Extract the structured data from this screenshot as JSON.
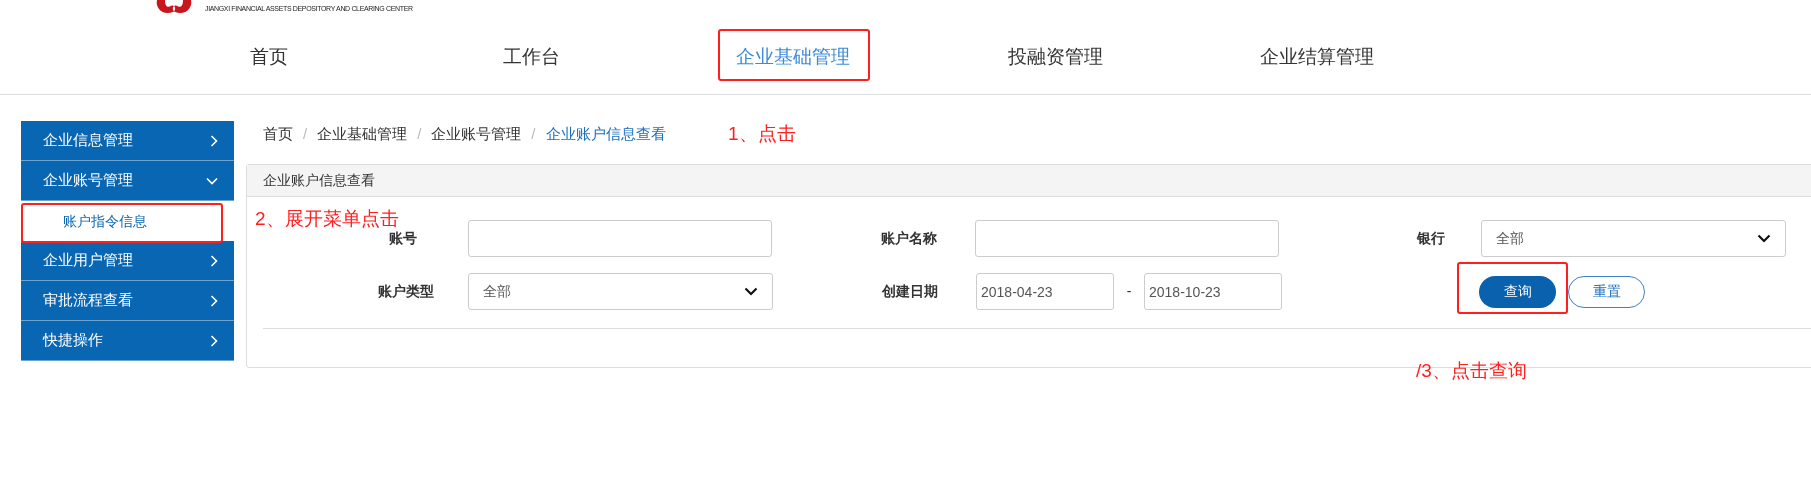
{
  "logo": {
    "subtitle": "JIANGXI FINANCIAL ASSETS DEPOSITORY AND CLEARING CENTER"
  },
  "nav": [
    {
      "label": "首页",
      "selected": false
    },
    {
      "label": "工作台",
      "selected": false
    },
    {
      "label": "企业基础管理",
      "selected": true
    },
    {
      "label": "投融资管理",
      "selected": false
    },
    {
      "label": "企业结算管理",
      "selected": false
    }
  ],
  "sidebar": {
    "items": [
      {
        "label": "企业信息管理",
        "expanded": false
      },
      {
        "label": "企业账号管理",
        "expanded": true,
        "children": [
          {
            "label": "账户指令信息",
            "selected": true
          }
        ]
      },
      {
        "label": "企业用户管理",
        "expanded": false
      },
      {
        "label": "审批流程查看",
        "expanded": false
      },
      {
        "label": "快捷操作",
        "expanded": false
      }
    ]
  },
  "breadcrumb": {
    "separator": "/",
    "items": [
      {
        "label": "首页",
        "current": false
      },
      {
        "label": "企业基础管理",
        "current": false
      },
      {
        "label": "企业账号管理",
        "current": false
      },
      {
        "label": "企业账户信息查看",
        "current": true
      }
    ]
  },
  "panel": {
    "title": "企业账户信息查看",
    "rows": [
      [
        {
          "kind": "text",
          "label": "账号"
        },
        {
          "kind": "text",
          "label": "账户名称"
        },
        {
          "kind": "select",
          "label": "银行",
          "value": "全部"
        }
      ],
      [
        {
          "kind": "select",
          "label": "账户类型",
          "value": "全部"
        },
        {
          "kind": "date_range",
          "label": "创建日期",
          "from": "2018-04-23",
          "separator": "-",
          "to": "2018-10-23"
        },
        {
          "kind": "buttons",
          "buttons": [
            {
              "label": "查询",
              "primary": true
            },
            {
              "label": "重置",
              "primary": false
            }
          ]
        }
      ]
    ]
  },
  "annotations": [
    {
      "text": "1、点击"
    },
    {
      "text": "2、展开菜单点击"
    },
    {
      "text": "/3、点击查询"
    }
  ]
}
